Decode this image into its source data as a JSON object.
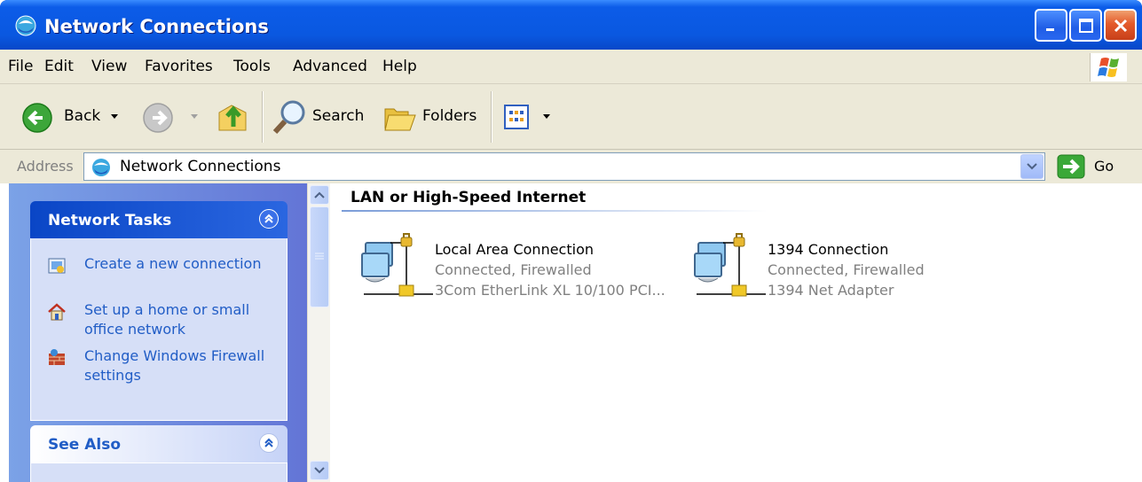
{
  "window": {
    "title": "Network Connections"
  },
  "menu": [
    {
      "label": "File"
    },
    {
      "label": "Edit"
    },
    {
      "label": "View"
    },
    {
      "label": "Favorites"
    },
    {
      "label": "Tools"
    },
    {
      "label": "Advanced"
    },
    {
      "label": "Help"
    }
  ],
  "toolbar": {
    "back_label": "Back",
    "search_label": "Search",
    "folders_label": "Folders"
  },
  "address": {
    "label": "Address",
    "value": "Network Connections",
    "go_label": "Go"
  },
  "sidebar": {
    "network_tasks": {
      "title": "Network Tasks",
      "items": [
        {
          "label": "Create a new connection",
          "icon": "new-connection-icon"
        },
        {
          "label": "Set up a home or small office network",
          "icon": "home-network-icon"
        },
        {
          "label": "Change Windows Firewall settings",
          "icon": "firewall-icon"
        }
      ]
    },
    "see_also": {
      "title": "See Also"
    }
  },
  "main": {
    "group_title": "LAN or High-Speed Internet",
    "connections": [
      {
        "name": "Local Area Connection",
        "status": "Connected, Firewalled",
        "adapter": "3Com EtherLink XL 10/100 PCI..."
      },
      {
        "name": "1394 Connection",
        "status": "Connected, Firewalled",
        "adapter": "1394 Net Adapter"
      }
    ]
  },
  "colors": {
    "titlebar": "#0a58e0",
    "chrome": "#ece9d8",
    "task_link": "#215dc6",
    "panel_header": "#215dc6",
    "side_pane": "#6f8fe0"
  }
}
